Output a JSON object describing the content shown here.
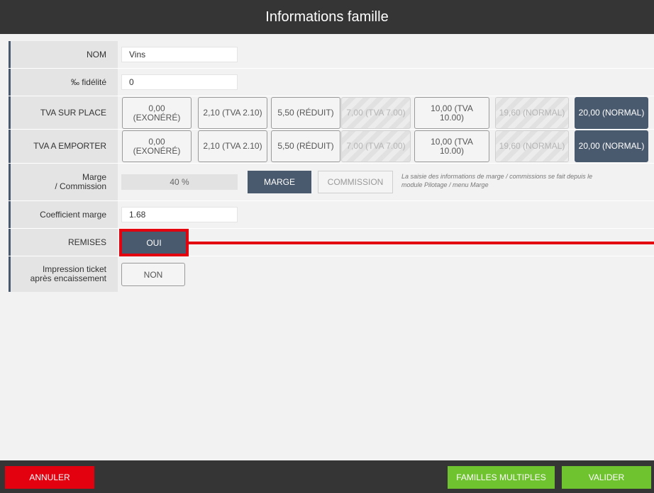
{
  "header": {
    "title": "Informations famille"
  },
  "form": {
    "nom": {
      "label": "NOM",
      "value": "Vins"
    },
    "fidelite": {
      "label": "‰ fidélité",
      "value": "0"
    },
    "tva_sur_place": {
      "label": "TVA SUR PLACE",
      "options": [
        {
          "text": "0,00 (EXONÉRÉ)",
          "state": "normal"
        },
        {
          "text": "2,10 (TVA 2.10)",
          "state": "normal"
        },
        {
          "text": "5,50 (RÉDUIT)",
          "state": "normal"
        },
        {
          "text": "7,00 (TVA 7.00)",
          "state": "disabled"
        },
        {
          "text": "10,00 (TVA 10.00)",
          "state": "normal"
        },
        {
          "text": "19,60 (NORMAL)",
          "state": "disabled"
        },
        {
          "text": "20,00 (NORMAL)",
          "state": "selected"
        }
      ]
    },
    "tva_a_emporter": {
      "label": "TVA A EMPORTER",
      "options": [
        {
          "text": "0,00 (EXONÉRÉ)",
          "state": "normal"
        },
        {
          "text": "2,10 (TVA 2.10)",
          "state": "normal"
        },
        {
          "text": "5,50 (RÉDUIT)",
          "state": "normal"
        },
        {
          "text": "7,00 (TVA 7.00)",
          "state": "disabled"
        },
        {
          "text": "10,00 (TVA 10.00)",
          "state": "normal"
        },
        {
          "text": "19,60 (NORMAL)",
          "state": "disabled"
        },
        {
          "text": "20,00 (NORMAL)",
          "state": "selected"
        }
      ]
    },
    "marge": {
      "label_line1": "Marge",
      "label_line2": "/ Commission",
      "value": "40 %",
      "marge_button": "MARGE",
      "commission_button": "COMMISSION",
      "note": "La saisie des informations de marge / commissions se fait depuis le module Pilotage / menu Marge"
    },
    "coefficient": {
      "label": "Coefficient marge",
      "value": "1.68"
    },
    "remises": {
      "label": "REMISES",
      "button": "OUI"
    },
    "impression": {
      "label_line1": "Impression ticket",
      "label_line2": "après encaissement",
      "button": "NON"
    }
  },
  "footer": {
    "cancel": "ANNULER",
    "multiple": "FAMILLES MULTIPLES",
    "validate": "VALIDER"
  },
  "colors": {
    "header_bg": "#353535",
    "selected": "#4a5a6e",
    "cancel": "#e3000f",
    "valider": "#6ec32f",
    "highlight": "#e3000f"
  }
}
